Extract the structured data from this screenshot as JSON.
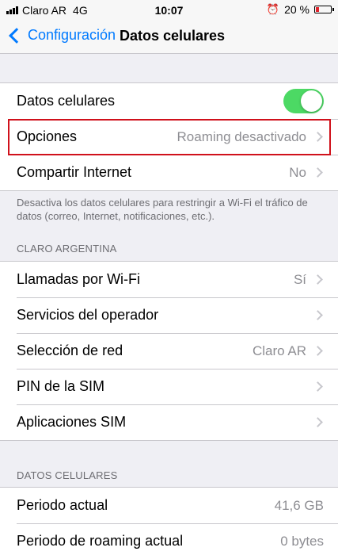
{
  "status_bar": {
    "carrier": "Claro AR",
    "network": "4G",
    "time": "10:07",
    "battery_percent": "20 %",
    "battery_level": 0.2,
    "battery_color": "#e0232b"
  },
  "nav": {
    "back_label": "Configuración",
    "title": "Datos celulares"
  },
  "group1": {
    "datos_celulares": {
      "label": "Datos celulares",
      "enabled": true
    },
    "opciones": {
      "label": "Opciones",
      "value": "Roaming desactivado"
    },
    "compartir": {
      "label": "Compartir Internet",
      "value": "No"
    }
  },
  "footer_note": "Desactiva los datos celulares para restringir a Wi-Fi el tráfico de datos (correo, Internet, notificaciones, etc.).",
  "section_claro": {
    "header": "CLARO ARGENTINA",
    "items": [
      {
        "label": "Llamadas por Wi-Fi",
        "value": "Sí"
      },
      {
        "label": "Servicios del operador",
        "value": ""
      },
      {
        "label": "Selección de red",
        "value": "Claro AR"
      },
      {
        "label": "PIN de la SIM",
        "value": ""
      },
      {
        "label": "Aplicaciones SIM",
        "value": ""
      }
    ]
  },
  "section_datos": {
    "header": "DATOS CELULARES",
    "items": [
      {
        "label": "Periodo actual",
        "value": "41,6 GB"
      },
      {
        "label": "Periodo de roaming actual",
        "value": "0 bytes"
      }
    ]
  },
  "colors": {
    "accent": "#007aff",
    "toggle_on": "#4cd964",
    "highlight": "#d0111b"
  }
}
